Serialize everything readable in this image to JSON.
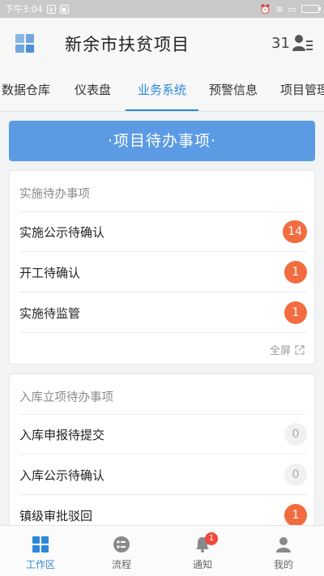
{
  "status_bar": {
    "time": "下午3:04"
  },
  "header": {
    "title": "新余市扶贫项目",
    "count": "31"
  },
  "tabs": [
    {
      "label": "数据仓库"
    },
    {
      "label": "仪表盘"
    },
    {
      "label": "业务系统"
    },
    {
      "label": "预警信息"
    },
    {
      "label": "项目管理"
    }
  ],
  "banner": {
    "label": "·项目待办事项·"
  },
  "card1": {
    "title": "实施待办事项",
    "rows": [
      {
        "label": "实施公示待确认",
        "count": "14"
      },
      {
        "label": "开工待确认",
        "count": "1"
      },
      {
        "label": "实施待监管",
        "count": "1"
      }
    ],
    "fullscreen": "全屏"
  },
  "card2": {
    "title": "入库立项待办事项",
    "rows": [
      {
        "label": "入库申报待提交",
        "count": "0"
      },
      {
        "label": "入库公示待确认",
        "count": "0"
      },
      {
        "label": "镇级审批驳回",
        "count": "1"
      }
    ]
  },
  "bottom_nav": [
    {
      "label": "工作区",
      "icon": "workspace-icon"
    },
    {
      "label": "流程",
      "icon": "flow-icon"
    },
    {
      "label": "通知",
      "icon": "bell-icon",
      "badge": "1"
    },
    {
      "label": "我的",
      "icon": "person-icon"
    }
  ],
  "colors": {
    "accent": "#2d89d8",
    "banner": "#5b9be3",
    "badge_hot": "#f26c40"
  }
}
